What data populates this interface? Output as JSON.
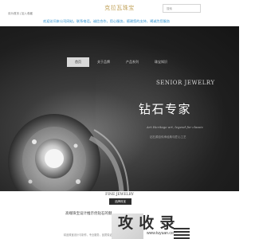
{
  "header": {
    "site_title": "克拉瓦珠宝",
    "top_links": "设为首页 | 加入收藏",
    "search_placeholder": "搜索"
  },
  "ticker": "欢迎访问本公司网站，联系电话，诚信合作，用心服务，感谢您的支持，竭诚为您服务",
  "nav": {
    "items": [
      "首页",
      "关于品牌",
      "产品系列",
      "珠宝知识"
    ]
  },
  "banner": {
    "brand_en": "SENIOR JEWELRY",
    "brand_zh": "钻石专家",
    "slogan": "Art Heritage art, legend for classic",
    "sub_zh": "钻石源自传承经典与匠心工艺",
    "pagination": [
      "1",
      "2",
      "3"
    ],
    "active_index": 0
  },
  "section": {
    "title_en": "FINE JEWELRY",
    "button_label": "品牌珠宝",
    "intro_text": "高端珠宝设计推示优钻石的魅",
    "caption": "精品珠宝设计与制作，专业服务，品质保证"
  },
  "watermark": {
    "text": "攻 收 录",
    "url": "www.tuyuan.com"
  },
  "colors": {
    "accent_gold": "#c2a35b",
    "link_blue": "#2a8fcf",
    "banner_dark": "#1f1f1f"
  }
}
